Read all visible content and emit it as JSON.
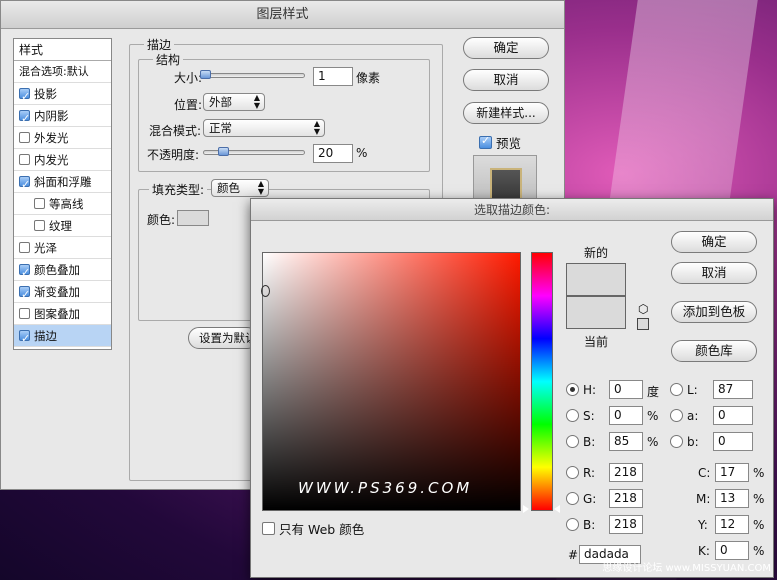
{
  "layer_style": {
    "title": "图层样式",
    "styles_header": "样式",
    "blend_options": "混合选项:默认",
    "items": [
      {
        "label": "投影",
        "checked": true
      },
      {
        "label": "内阴影",
        "checked": true
      },
      {
        "label": "外发光",
        "checked": false
      },
      {
        "label": "内发光",
        "checked": false
      },
      {
        "label": "斜面和浮雕",
        "checked": true
      },
      {
        "label": "等高线",
        "checked": false
      },
      {
        "label": "纹理",
        "checked": false
      },
      {
        "label": "光泽",
        "checked": false
      },
      {
        "label": "颜色叠加",
        "checked": true
      },
      {
        "label": "渐变叠加",
        "checked": true
      },
      {
        "label": "图案叠加",
        "checked": false
      },
      {
        "label": "描边",
        "checked": true
      }
    ],
    "stroke_group": "描边",
    "structure_group": "结构",
    "size_label": "大小:",
    "size_value": "1",
    "size_unit": "像素",
    "position_label": "位置:",
    "position_value": "外部",
    "blend_mode_label": "混合模式:",
    "blend_mode_value": "正常",
    "opacity_label": "不透明度:",
    "opacity_value": "20",
    "opacity_unit": "%",
    "fill_type_label": "填充类型:",
    "fill_type_value": "颜色",
    "color_label": "颜色:",
    "set_default_button": "设置为默认",
    "ok_button": "确定",
    "cancel_button": "取消",
    "new_style_button": "新建样式...",
    "preview_label": "预览",
    "preview_checked": true
  },
  "picker": {
    "title": "选取描边颜色:",
    "new_label": "新的",
    "current_label": "当前",
    "ok_button": "确定",
    "cancel_button": "取消",
    "add_swatch_button": "添加到色板",
    "color_library_button": "颜色库",
    "watermark": "WWW.PS369.COM",
    "web_only_label": "只有 Web 颜色",
    "hsb": [
      {
        "label": "H:",
        "value": "0",
        "unit": "度",
        "selected": true
      },
      {
        "label": "S:",
        "value": "0",
        "unit": "%",
        "selected": false
      },
      {
        "label": "B:",
        "value": "85",
        "unit": "%",
        "selected": false
      }
    ],
    "lab": [
      {
        "label": "L:",
        "value": "87"
      },
      {
        "label": "a:",
        "value": "0"
      },
      {
        "label": "b:",
        "value": "0"
      }
    ],
    "rgb": [
      {
        "label": "R:",
        "value": "218"
      },
      {
        "label": "G:",
        "value": "218"
      },
      {
        "label": "B:",
        "value": "218"
      }
    ],
    "cmyk": [
      {
        "label": "C:",
        "value": "17",
        "unit": "%"
      },
      {
        "label": "M:",
        "value": "13",
        "unit": "%"
      },
      {
        "label": "Y:",
        "value": "12",
        "unit": "%"
      },
      {
        "label": "K:",
        "value": "0",
        "unit": "%"
      }
    ],
    "hex_label": "#",
    "hex_value": "dadada",
    "swatch_color": "#dadada"
  },
  "credit": "思缘设计论坛 www.MISSYUAN.COM"
}
